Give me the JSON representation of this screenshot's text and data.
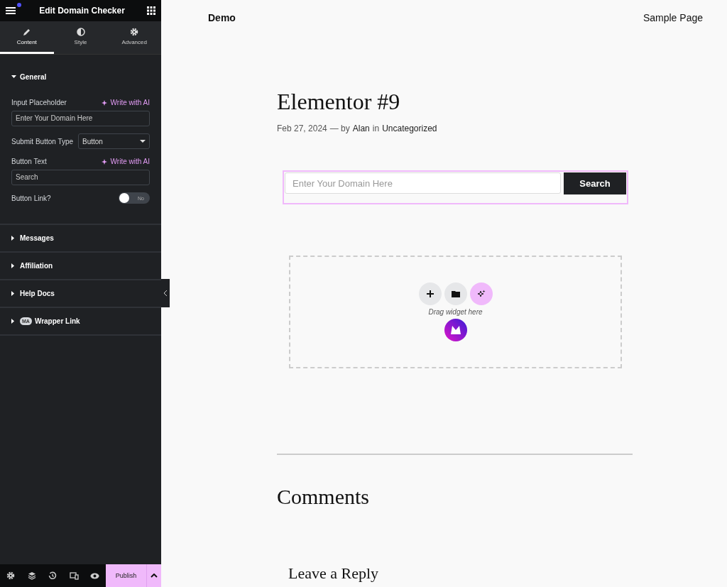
{
  "editor": {
    "title": "Edit Domain Checker",
    "has_notification": true,
    "tabs": [
      {
        "label": "Content",
        "selected": true
      },
      {
        "label": "Style",
        "selected": false
      },
      {
        "label": "Advanced",
        "selected": false
      }
    ],
    "sections": [
      {
        "title": "General",
        "expanded": true,
        "controls": [
          {
            "kind": "text",
            "label": "Input Placeholder",
            "ai": "Write with AI",
            "value": "Enter Your Domain Here"
          },
          {
            "kind": "select",
            "label": "Submit Button Type",
            "value": "Button"
          },
          {
            "kind": "text",
            "label": "Button Text",
            "ai": "Write with AI",
            "value": "Search"
          },
          {
            "kind": "switch",
            "label": "Button Link?",
            "on": false,
            "state_text": "No"
          }
        ]
      },
      {
        "title": "Messages",
        "expanded": false
      },
      {
        "title": "Affiliation",
        "expanded": false
      },
      {
        "title": "Help Docs",
        "expanded": false
      },
      {
        "title": "Wrapper Link",
        "expanded": false,
        "badge": "MA"
      }
    ],
    "footer": {
      "publish": "Publish"
    }
  },
  "site": {
    "name": "Demo",
    "nav": "Sample Page"
  },
  "post": {
    "title": "Elementor #9",
    "date": "Feb 27, 2024",
    "sep": "— by",
    "author": "Alan",
    "in": "in",
    "category": "Uncategorized",
    "domain_search": {
      "placeholder": "Enter Your Domain Here",
      "button": "Search"
    },
    "drop_zone": {
      "hint": "Drag widget here"
    },
    "comments_title": "Comments",
    "reply_title": "Leave a Reply"
  }
}
